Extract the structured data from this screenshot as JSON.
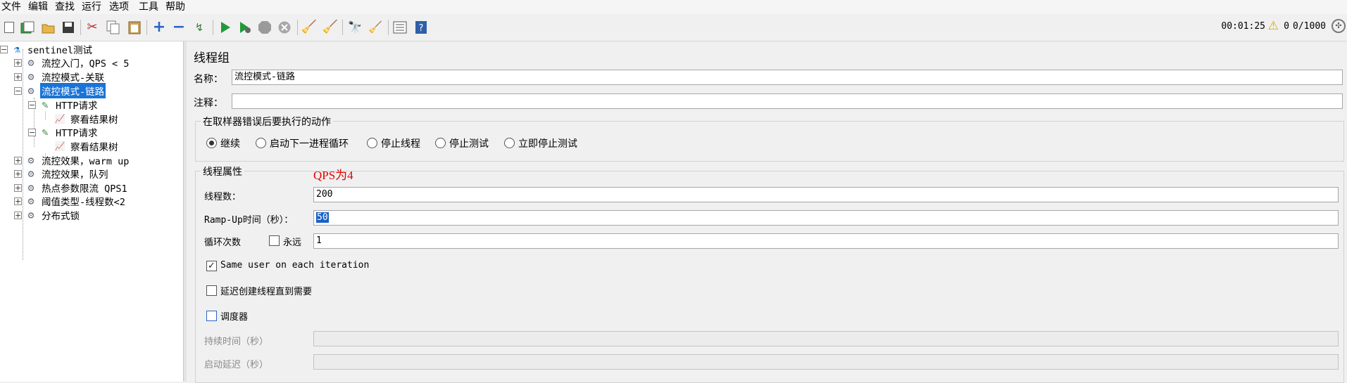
{
  "menu": [
    "文件",
    "编辑",
    "查找",
    "运行",
    "选项",
    "工具",
    "帮助"
  ],
  "toolbar": {
    "icons": [
      "new-icon",
      "templates-icon",
      "open-icon",
      "save-icon",
      "cut-icon",
      "copy-icon",
      "paste-icon",
      "expand-icon",
      "collapse-icon",
      "toggle-icon",
      "start-icon",
      "start-no-pause-icon",
      "stop-icon",
      "shutdown-icon",
      "clear-icon",
      "clear-all-icon",
      "search-icon",
      "reset-search-icon",
      "function-helper-icon",
      "help-icon"
    ],
    "timer": "00:01:25",
    "error_count": "0",
    "threads": "0/1000"
  },
  "tree": {
    "root": "sentinel测试",
    "items": [
      {
        "label": "流控入门，QPS < 5",
        "expanded": false
      },
      {
        "label": "流控模式-关联",
        "expanded": false
      },
      {
        "label": "流控模式-链路",
        "expanded": true,
        "selected": true
      },
      {
        "label": "HTTP请求"
      },
      {
        "label": "察看结果树"
      },
      {
        "label": "HTTP请求"
      },
      {
        "label": "察看结果树"
      },
      {
        "label": "流控效果，warm up",
        "expanded": false
      },
      {
        "label": "流控效果，队列",
        "expanded": false
      },
      {
        "label": "热点参数限流 QPS1",
        "expanded": false
      },
      {
        "label": "阈值类型-线程数<2",
        "expanded": false
      },
      {
        "label": "分布式锁",
        "expanded": false
      }
    ]
  },
  "form": {
    "title": "线程组",
    "name_label": "名称：",
    "name_value": "流控模式-链路",
    "comment_label": "注释：",
    "comment_value": "",
    "error_group_title": "在取样器错误后要执行的动作",
    "error_options": [
      "继续",
      "启动下一进程循环",
      "停止线程",
      "停止测试",
      "立即停止测试"
    ],
    "error_selected": 0,
    "thread_group_title": "线程属性",
    "annotation": "QPS为4",
    "threads_label": "线程数：",
    "threads_value": "200",
    "rampup_label": "Ramp-Up时间（秒）：",
    "rampup_value": "50",
    "loop_label": "循环次数",
    "forever_label": "永远",
    "forever_checked": false,
    "loop_value": "1",
    "same_user_label": "Same user on each iteration",
    "same_user_checked": true,
    "delay_label": "延迟创建线程直到需要",
    "delay_checked": false,
    "scheduler_label": "调度器",
    "scheduler_checked": false,
    "duration_label": "持续时间（秒）",
    "duration_value": "",
    "startup_delay_label": "启动延迟（秒）",
    "startup_delay_value": ""
  },
  "colors": {
    "selection": "#1a74d8",
    "annotation": "#e00000"
  }
}
